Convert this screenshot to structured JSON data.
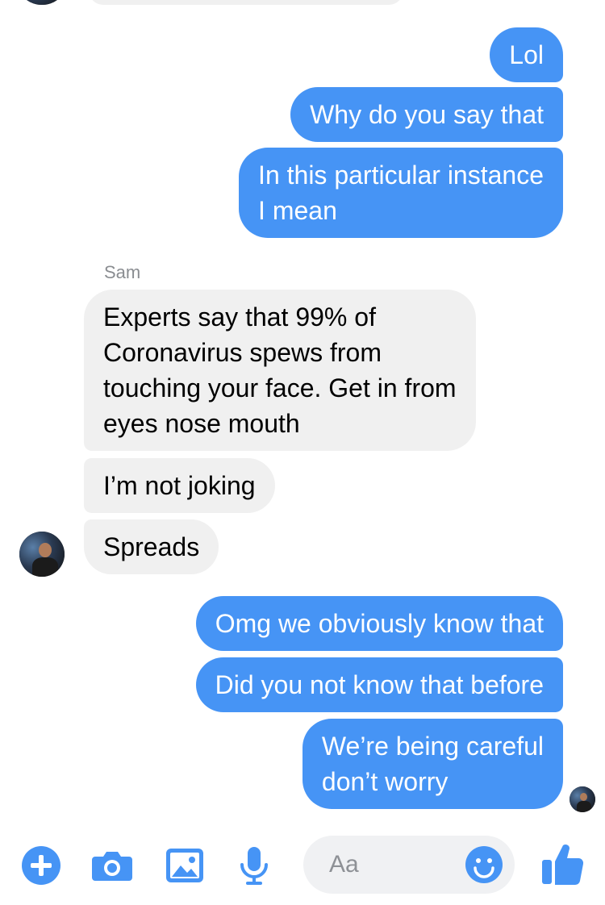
{
  "conversation": {
    "sender_name": "Sam",
    "messages": [
      {
        "side": "out",
        "text": "Lol"
      },
      {
        "side": "out",
        "text": "Why do you say that"
      },
      {
        "side": "out",
        "text": "In this particular instance\nI mean"
      },
      {
        "side": "in",
        "text": "Experts say that 99% of\nCoronavirus spews from\ntouching your face. Get in from\neyes nose mouth"
      },
      {
        "side": "in",
        "text": "I’m not joking"
      },
      {
        "side": "in",
        "text": "Spreads"
      },
      {
        "side": "out",
        "text": "Omg we obviously know that"
      },
      {
        "side": "out",
        "text": "Did you not know that before"
      },
      {
        "side": "out",
        "text": "We’re being careful\ndon’t worry"
      }
    ]
  },
  "composer": {
    "placeholder": "Aa",
    "icons": [
      "plus-icon",
      "camera-icon",
      "image-icon",
      "microphone-icon",
      "emoji-icon",
      "thumbs-up-icon"
    ]
  },
  "colors": {
    "accent": "#4694f5",
    "incoming_bubble": "#f0f0f0",
    "sender_label": "#8a8d91"
  }
}
